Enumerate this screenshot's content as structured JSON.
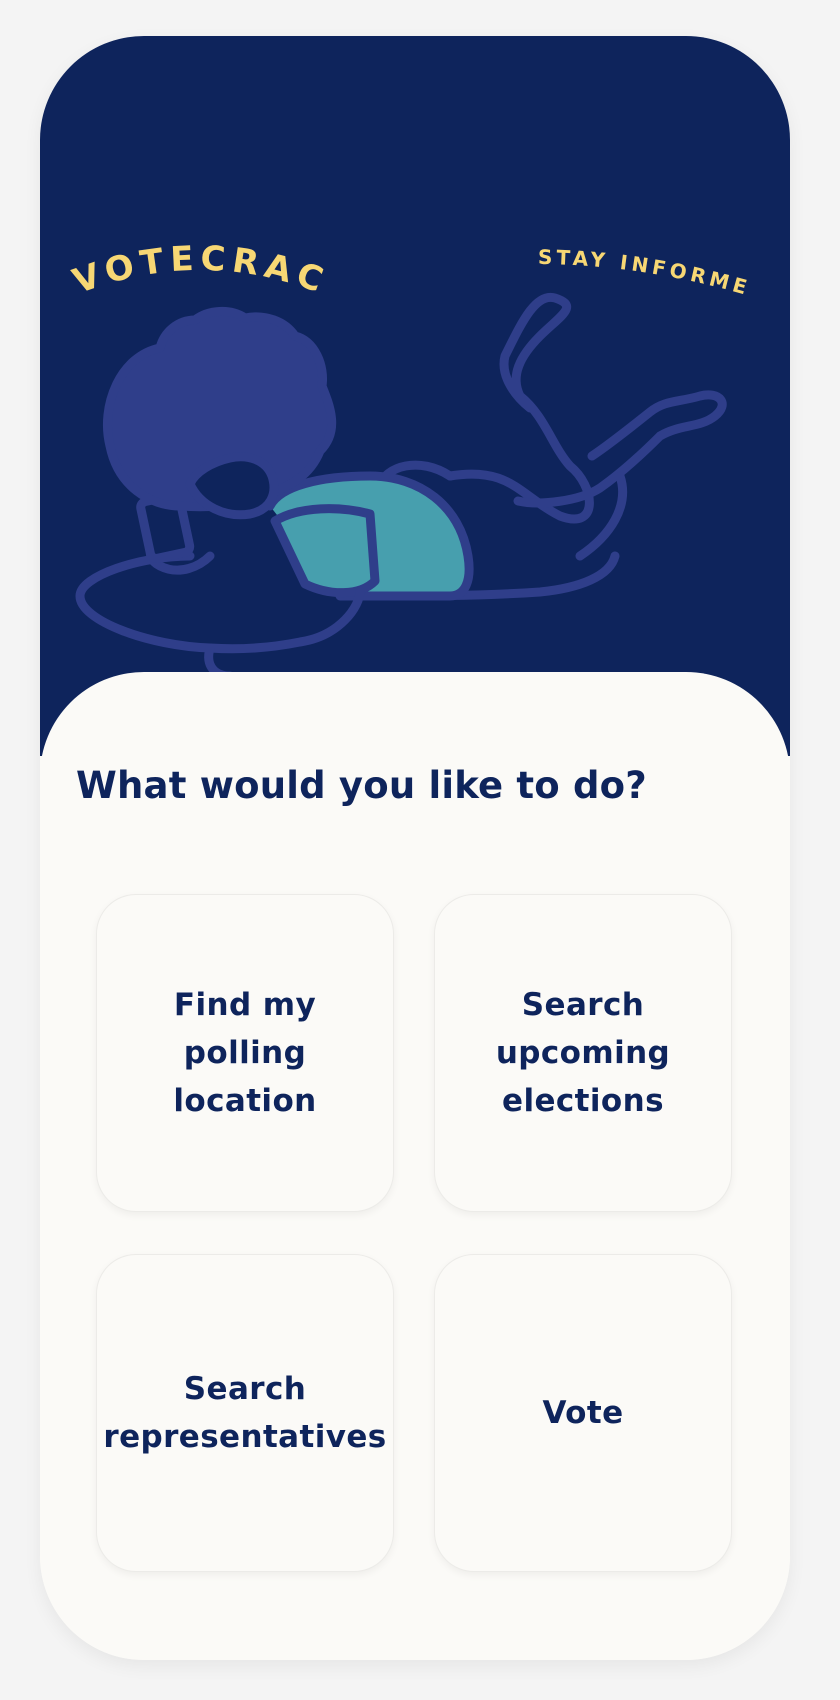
{
  "hero": {
    "brand": "VOTECRACY",
    "tagline": "STAY INFORMED.",
    "illustration": "person-lying-reading-phone-illustration",
    "colors": {
      "background": "#0e245c",
      "text": "#f7d774",
      "hair_outline": "#2f3e8a",
      "shirt": "#479fae"
    }
  },
  "main": {
    "question": "What would you like to do?",
    "actions": [
      {
        "label": "Find my polling location"
      },
      {
        "label": "Search upcoming elections"
      },
      {
        "label": "Search representatives"
      },
      {
        "label": "Vote"
      }
    ]
  },
  "colors": {
    "navy": "#0e245c",
    "card_background": "#fbfaf7"
  }
}
